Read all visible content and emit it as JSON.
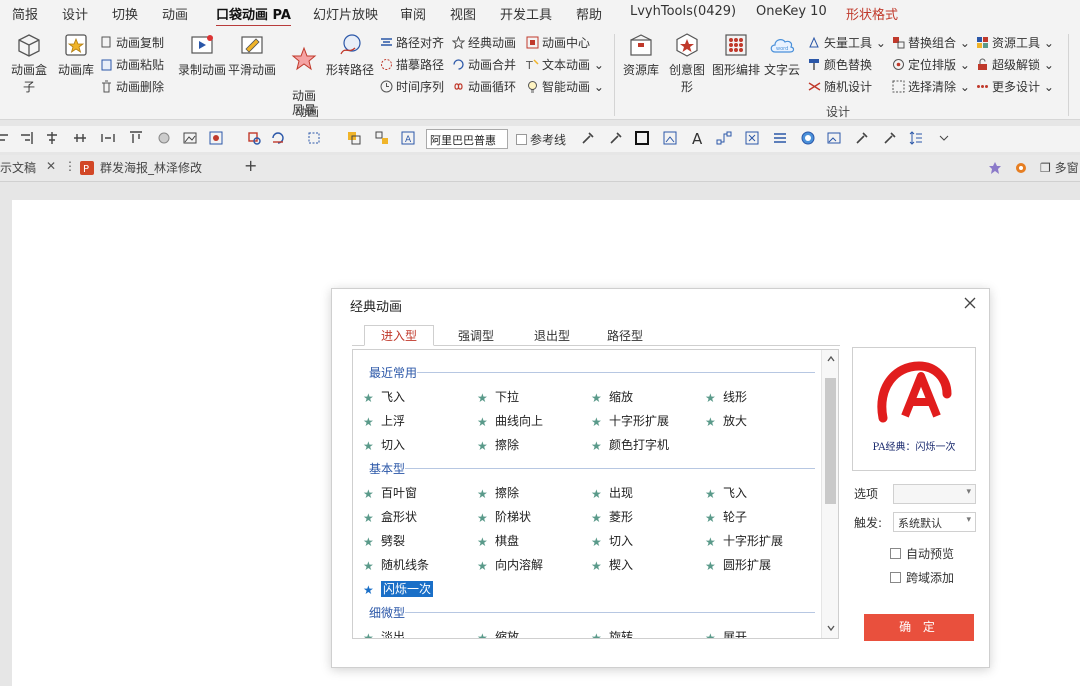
{
  "menu": {
    "tabs": [
      "简报",
      "设计",
      "切换",
      "动画",
      "口袋动画 PA",
      "幻灯片放映",
      "审阅",
      "视图",
      "开发工具",
      "帮助",
      "LvyhTools(0429)",
      "OneKey 10",
      "形状格式"
    ],
    "active_tab": "口袋动画 PA"
  },
  "ribbon": {
    "animation_group": {
      "box": "动画盒子",
      "library": "动画库",
      "copy": "动画复制",
      "paste": "动画粘贴",
      "delete": "动画删除",
      "record": "录制动画",
      "smooth": "平滑动画",
      "storm": "动画\n风暴",
      "morph_path": "形转路径",
      "path_align": "路径对齐",
      "trace_path": "描摹路径",
      "timeline": "时间序列",
      "classic": "经典动画",
      "merge": "动画合并",
      "loop": "动画循环",
      "center": "动画中心",
      "text_anim": "文本动画",
      "smart": "智能动画",
      "label": "动画"
    },
    "design_group": {
      "resource": "资源库",
      "creative": "创意图形",
      "arrange": "图形编排",
      "wordcloud": "文字云",
      "word_icon_text": "word",
      "vector": "矢量工具",
      "recolor": "颜色替换",
      "random": "随机设计",
      "replace_combo": "替换组合",
      "position": "定位排版",
      "select_clear": "选择清除",
      "res_tool": "资源工具",
      "unlock": "超级解锁",
      "more": "更多设计",
      "label": "设计"
    }
  },
  "toolbar": {
    "font": "阿里巴巴普惠",
    "reference_line": "参考线"
  },
  "doc_tabs": {
    "first": "示文稿",
    "second": "群发海报_林泽修改",
    "add": "+",
    "right_label": "多窗"
  },
  "dialog": {
    "title": "经典动画",
    "tabs": [
      "进入型",
      "强调型",
      "退出型",
      "路径型"
    ],
    "active_tab": "进入型",
    "sections": {
      "recent": {
        "title": "最近常用",
        "items": [
          "飞入",
          "下拉",
          "缩放",
          "线形",
          "上浮",
          "曲线向上",
          "十字形扩展",
          "放大",
          "切入",
          "擦除",
          "颜色打字机"
        ]
      },
      "basic": {
        "title": "基本型",
        "items": [
          "百叶窗",
          "擦除",
          "出现",
          "飞入",
          "盒形状",
          "阶梯状",
          "菱形",
          "轮子",
          "劈裂",
          "棋盘",
          "切入",
          "十字形扩展",
          "随机线条",
          "向内溶解",
          "楔入",
          "圆形扩展",
          "闪烁一次"
        ]
      },
      "subtle": {
        "title": "细微型",
        "items": [
          "淡出",
          "缩放",
          "旋转",
          "展开"
        ]
      }
    },
    "selected_item": "闪烁一次",
    "preview_caption": "PA经典：闪烁一次",
    "option_label": "选项",
    "option_value": "",
    "trigger_label": "触发:",
    "trigger_value": "系统默认",
    "auto_preview": "自动预览",
    "cross_add": "跨域添加",
    "ok": "确 定"
  },
  "colors": {
    "accent_red": "#c0392b",
    "ok_button": "#e9503d",
    "section_blue": "#2b57a8",
    "star_green": "#5a9a8a",
    "selection_blue": "#1a6fc7"
  }
}
